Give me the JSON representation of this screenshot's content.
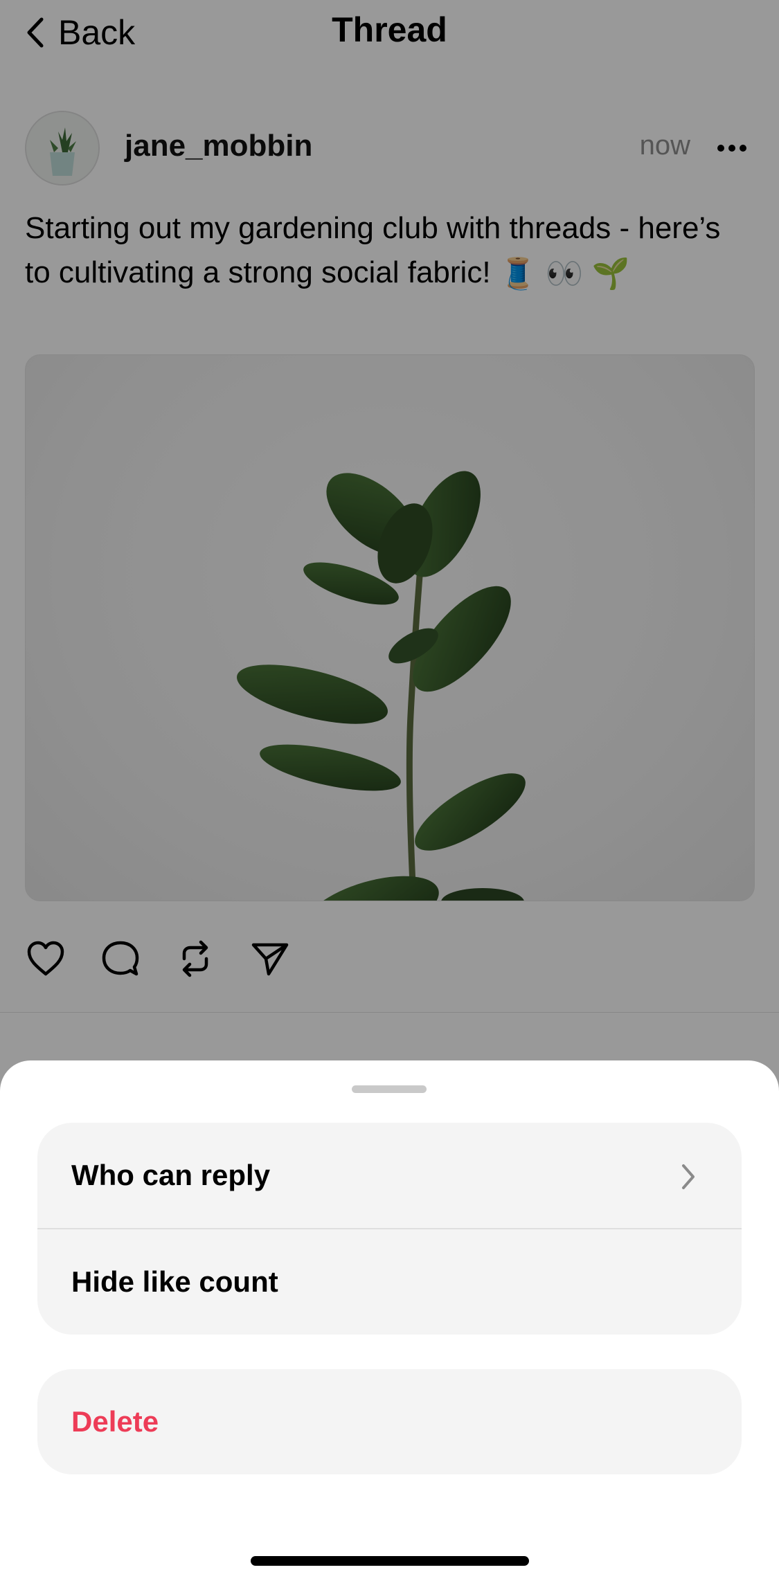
{
  "header": {
    "back_label": "Back",
    "title": "Thread"
  },
  "post": {
    "username": "jane_mobbin",
    "timestamp": "now",
    "text": "Starting out my gardening club with threads - here’s to cultivating a strong social fabric!",
    "emojis": [
      "🧵",
      "👀",
      "🌱"
    ]
  },
  "sheet": {
    "group1": [
      {
        "label": "Who can reply",
        "has_chevron": true
      },
      {
        "label": "Hide like count",
        "has_chevron": false
      }
    ],
    "delete_label": "Delete"
  },
  "colors": {
    "danger": "#ed3c57",
    "sheet_group_bg": "#f4f4f4",
    "muted": "#8e8e8e"
  }
}
